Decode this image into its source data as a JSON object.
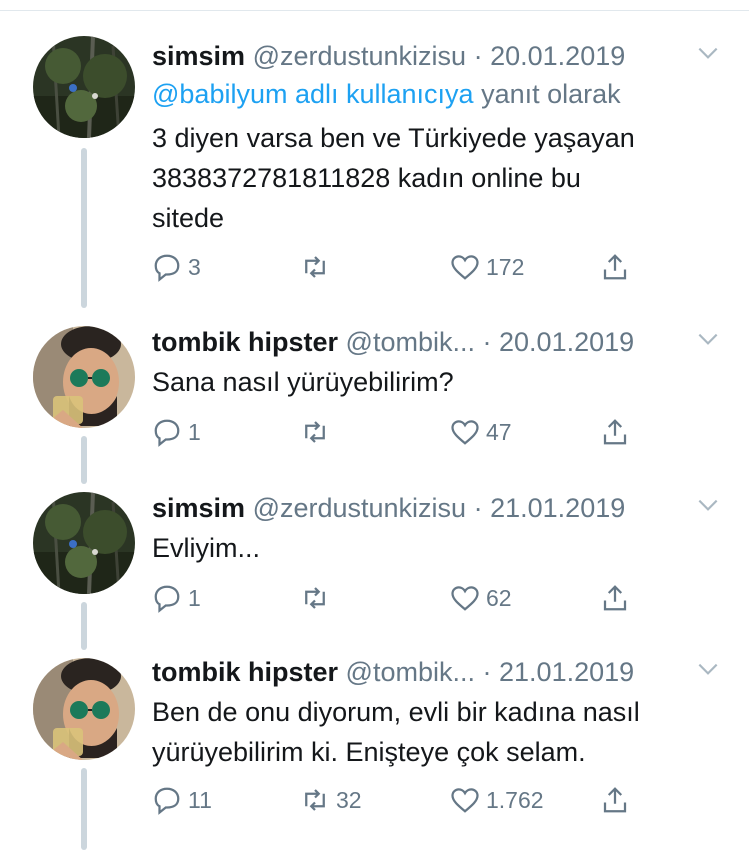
{
  "tweets": [
    {
      "name": "simsim",
      "handle": "@zerdustunkizisu",
      "dot": "·",
      "date": "20.01.2019",
      "reply_mention": "@babilyum adlı kullanıcıya",
      "reply_suffix": "yanıt olarak",
      "lines": [
        "3 diyen varsa ben ve Türkiyede yaşayan",
        "3838372781811828 kadın online bu",
        "sitede"
      ],
      "replies": "3",
      "retweets": "",
      "likes": "172",
      "avatar": "forest"
    },
    {
      "name": "tombik hipster",
      "handle": "@tombik...",
      "dot": "·",
      "date": "20.01.2019",
      "lines": [
        "Sana nasıl yürüyebilirim?"
      ],
      "replies": "1",
      "retweets": "",
      "likes": "47",
      "avatar": "person"
    },
    {
      "name": "simsim",
      "handle": "@zerdustunkizisu",
      "dot": "·",
      "date": "21.01.2019",
      "lines": [
        "Evliyim..."
      ],
      "replies": "1",
      "retweets": "",
      "likes": "62",
      "avatar": "forest"
    },
    {
      "name": "tombik hipster",
      "handle": "@tombik...",
      "dot": "·",
      "date": "21.01.2019",
      "lines": [
        "Ben de onu diyorum, evli bir kadına nasıl",
        "yürüyebilirim ki. Enişteye çok selam."
      ],
      "replies": "11",
      "retweets": "32",
      "likes": "1.762",
      "avatar": "person"
    }
  ],
  "colors": {
    "text": "#14171a",
    "secondary": "#657786",
    "link": "#1da1f2",
    "thread_line": "#ccd6dd"
  }
}
